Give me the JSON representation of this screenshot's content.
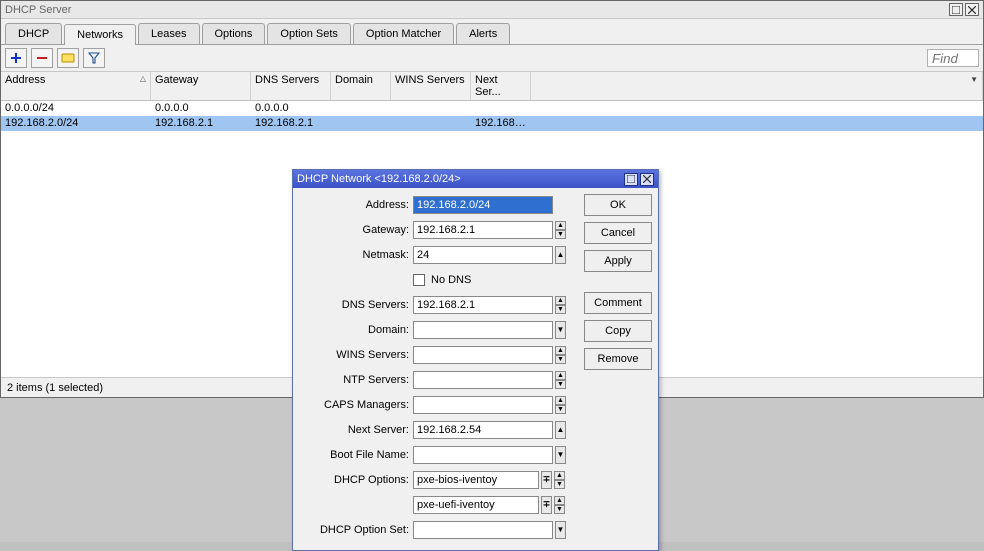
{
  "window": {
    "title": "DHCP Server"
  },
  "tabs": [
    "DHCP",
    "Networks",
    "Leases",
    "Options",
    "Option Sets",
    "Option Matcher",
    "Alerts"
  ],
  "activeTab": "Networks",
  "find_placeholder": "Find",
  "columns": {
    "address": "Address",
    "gateway": "Gateway",
    "dns": "DNS Servers",
    "domain": "Domain",
    "wins": "WINS Servers",
    "next": "Next Ser..."
  },
  "rows": [
    {
      "address": "0.0.0.0/24",
      "gateway": "0.0.0.0",
      "dns": "0.0.0.0",
      "domain": "",
      "wins": "",
      "next": ""
    },
    {
      "address": "192.168.2.0/24",
      "gateway": "192.168.2.1",
      "dns": "192.168.2.1",
      "domain": "",
      "wins": "",
      "next": "192.168...."
    }
  ],
  "status": "2 items (1 selected)",
  "dialog": {
    "title": "DHCP Network <192.168.2.0/24>",
    "labels": {
      "address": "Address:",
      "gateway": "Gateway:",
      "netmask": "Netmask:",
      "nodns": "No DNS",
      "dns": "DNS Servers:",
      "domain": "Domain:",
      "wins": "WINS Servers:",
      "ntp": "NTP Servers:",
      "caps": "CAPS Managers:",
      "next": "Next Server:",
      "boot": "Boot File Name:",
      "dhcpopts": "DHCP Options:",
      "optset": "DHCP Option Set:"
    },
    "values": {
      "address": "192.168.2.0/24",
      "gateway": "192.168.2.1",
      "netmask": "24",
      "dns": "192.168.2.1",
      "domain": "",
      "wins": "",
      "ntp": "",
      "caps": "",
      "next": "192.168.2.54",
      "boot": "",
      "dhcpopt1": "pxe-bios-iventoy",
      "dhcpopt2": "pxe-uefi-iventoy",
      "optset": ""
    },
    "buttons": {
      "ok": "OK",
      "cancel": "Cancel",
      "apply": "Apply",
      "comment": "Comment",
      "copy": "Copy",
      "remove": "Remove"
    }
  }
}
